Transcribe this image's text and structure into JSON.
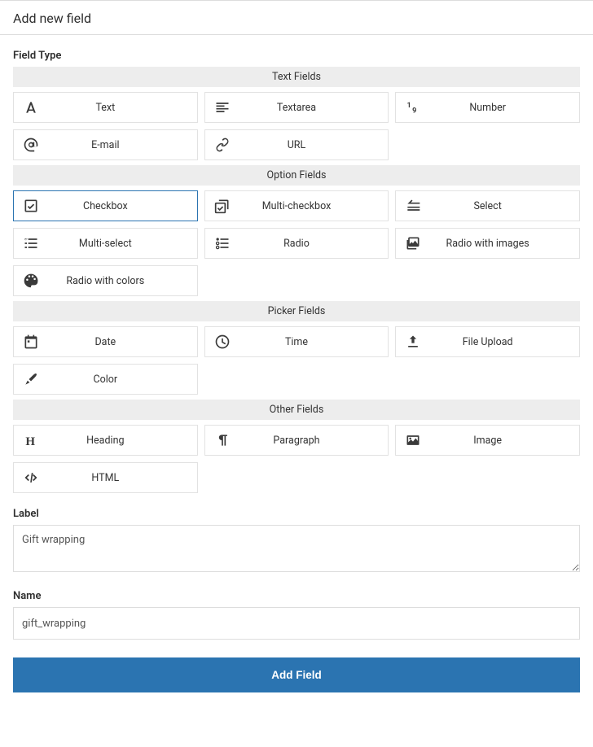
{
  "page_title": "Add new field",
  "field_type_label": "Field Type",
  "groups": [
    {
      "header": "Text Fields",
      "tiles": [
        {
          "name": "text",
          "icon": "font-icon",
          "label": "Text"
        },
        {
          "name": "textarea",
          "icon": "align-left-icon",
          "label": "Textarea"
        },
        {
          "name": "number",
          "icon": "one-nine-icon",
          "label": "Number"
        },
        {
          "name": "email",
          "icon": "at-icon",
          "label": "E-mail"
        },
        {
          "name": "url",
          "icon": "link-icon",
          "label": "URL"
        }
      ]
    },
    {
      "header": "Option Fields",
      "tiles": [
        {
          "name": "checkbox",
          "icon": "checkbox-icon",
          "label": "Checkbox",
          "selected": true
        },
        {
          "name": "multi-checkbox",
          "icon": "multi-checkbox-icon",
          "label": "Multi-checkbox"
        },
        {
          "name": "select",
          "icon": "select-icon",
          "label": "Select"
        },
        {
          "name": "multi-select",
          "icon": "multi-select-icon",
          "label": "Multi-select"
        },
        {
          "name": "radio",
          "icon": "radio-icon",
          "label": "Radio"
        },
        {
          "name": "radio-images",
          "icon": "images-icon",
          "label": "Radio with images"
        },
        {
          "name": "radio-colors",
          "icon": "palette-icon",
          "label": "Radio with colors"
        }
      ]
    },
    {
      "header": "Picker Fields",
      "tiles": [
        {
          "name": "date",
          "icon": "calendar-icon",
          "label": "Date"
        },
        {
          "name": "time",
          "icon": "clock-icon",
          "label": "Time"
        },
        {
          "name": "file-upload",
          "icon": "upload-icon",
          "label": "File Upload"
        },
        {
          "name": "color",
          "icon": "brush-icon",
          "label": "Color"
        }
      ]
    },
    {
      "header": "Other Fields",
      "tiles": [
        {
          "name": "heading",
          "icon": "heading-icon",
          "label": "Heading"
        },
        {
          "name": "paragraph",
          "icon": "pilcrow-icon",
          "label": "Paragraph"
        },
        {
          "name": "image",
          "icon": "image-icon",
          "label": "Image"
        },
        {
          "name": "html",
          "icon": "code-icon",
          "label": "HTML"
        }
      ]
    }
  ],
  "label_field": {
    "label": "Label",
    "value": "Gift wrapping"
  },
  "name_field": {
    "label": "Name",
    "value": "gift_wrapping"
  },
  "submit_label": "Add Field"
}
